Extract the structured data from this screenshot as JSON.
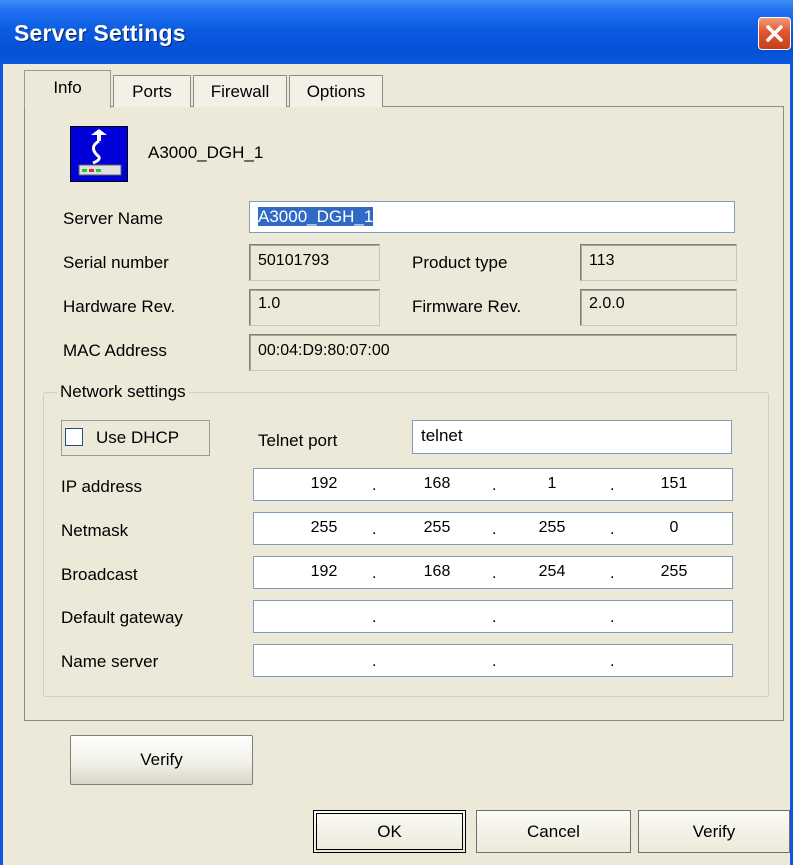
{
  "window": {
    "title": "Server Settings"
  },
  "tabs": [
    {
      "label": "Info"
    },
    {
      "label": "Ports"
    },
    {
      "label": "Firewall"
    },
    {
      "label": "Options"
    }
  ],
  "device": {
    "name": "A3000_DGH_1",
    "icon": "network-device-icon"
  },
  "fields": {
    "server_name_label": "Server Name",
    "server_name_value": "A3000_DGH_1",
    "serial_label": "Serial number",
    "serial_value": "50101793",
    "product_type_label": "Product type",
    "product_type_value": "113",
    "hardware_rev_label": "Hardware Rev.",
    "hardware_rev_value": "1.0",
    "firmware_rev_label": "Firmware Rev.",
    "firmware_rev_value": "2.0.0",
    "mac_label": "MAC Address",
    "mac_value": "00:04:D9:80:07:00"
  },
  "network": {
    "group_label": "Network settings",
    "dhcp_label": "Use DHCP",
    "dhcp_checked": false,
    "telnet_label": "Telnet port",
    "telnet_value": "telnet",
    "dot": ".",
    "ip_label": "IP address",
    "ip": [
      "192",
      "168",
      "1",
      "151"
    ],
    "netmask_label": "Netmask",
    "netmask": [
      "255",
      "255",
      "255",
      "0"
    ],
    "broadcast_label": "Broadcast",
    "broadcast": [
      "192",
      "168",
      "254",
      "255"
    ],
    "gateway_label": "Default gateway",
    "gateway": [
      "",
      "",
      "",
      ""
    ],
    "nameserver_label": "Name server",
    "nameserver": [
      "",
      "",
      "",
      ""
    ]
  },
  "buttons": {
    "verify_inner": "Verify",
    "ok": "OK",
    "cancel": "Cancel",
    "verify": "Verify"
  },
  "colors": {
    "titlebar": "#0a58de",
    "close": "#e1552f",
    "dialog_bg": "#ece9d8",
    "selection": "#316ac5"
  }
}
